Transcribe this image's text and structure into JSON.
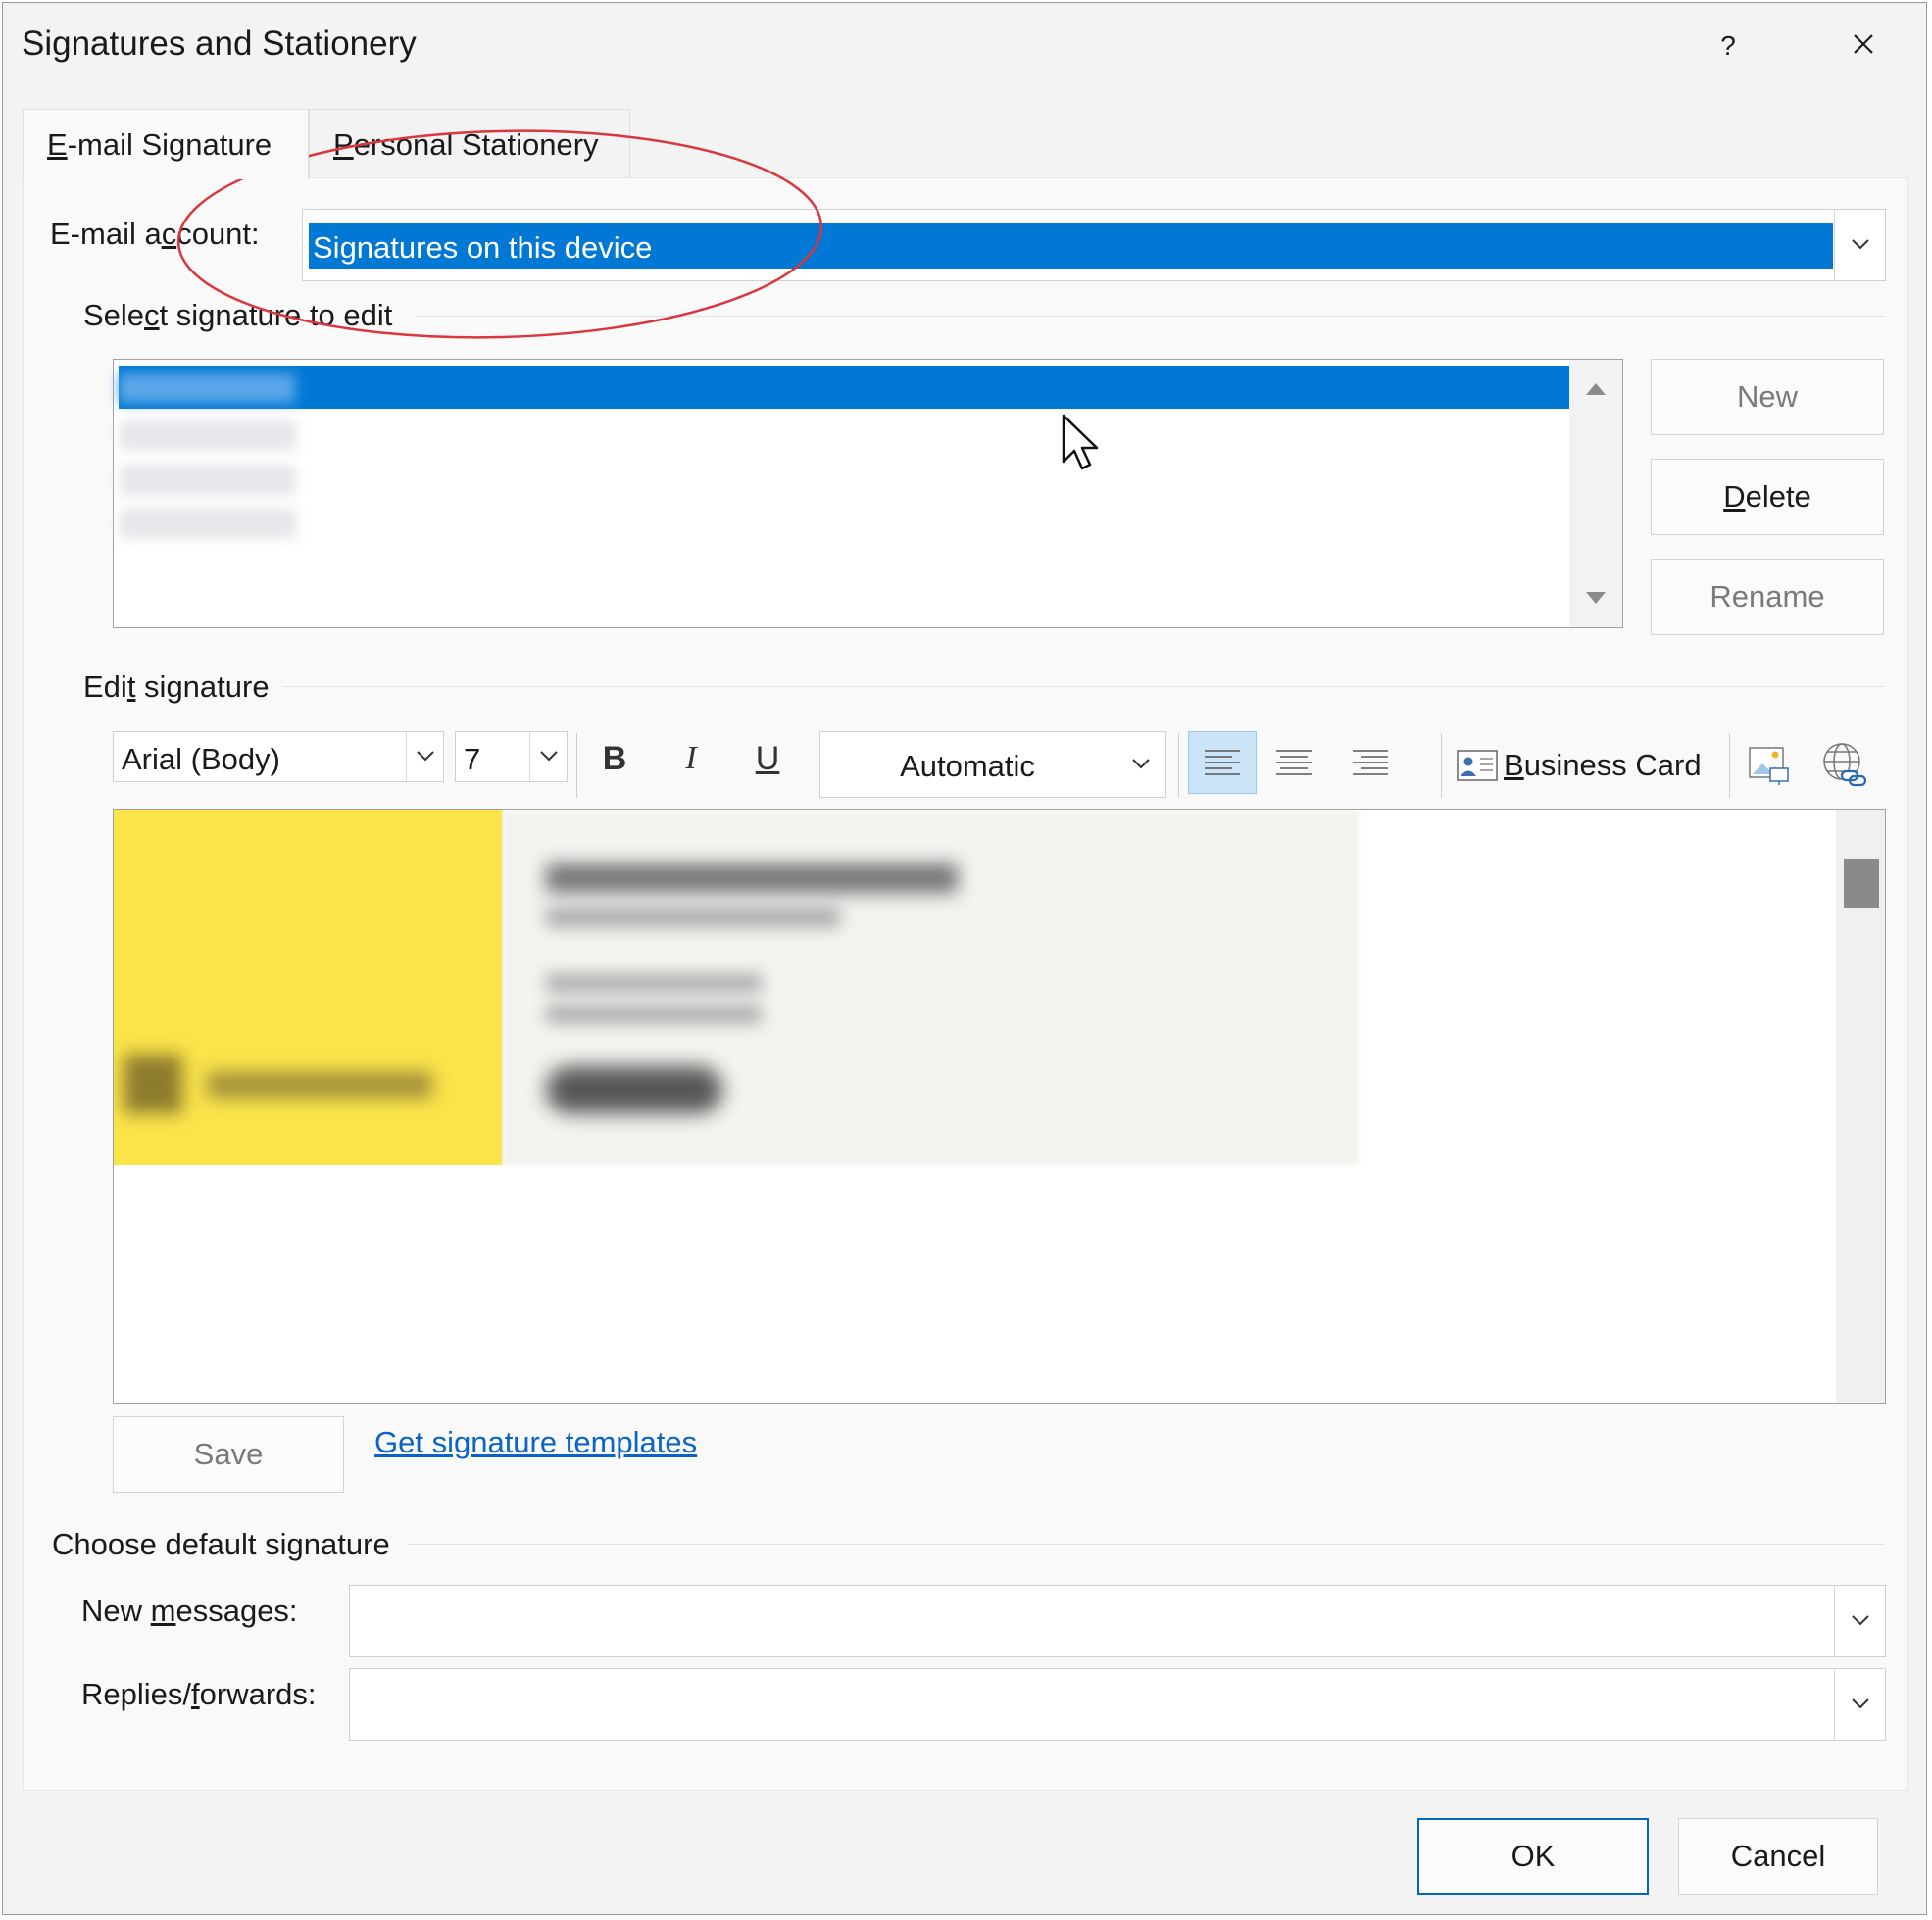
{
  "window": {
    "title": "Signatures and Stationery",
    "help_label": "?"
  },
  "tabs": [
    {
      "label": "E-mail Signature",
      "mnemonic": "E",
      "active": true
    },
    {
      "label": "Personal Stationery",
      "mnemonic": "P",
      "active": false
    }
  ],
  "email_account": {
    "label_prefix": "E-mail a",
    "label_mnemonic": "c",
    "label_suffix": "count:",
    "value": "Signatures on this device"
  },
  "select_signature": {
    "label_prefix": "Sele",
    "label_mnemonic": "c",
    "label_suffix": "t signature to edit",
    "items_blurred": true
  },
  "side_buttons": {
    "new_label": "New",
    "delete_mnemonic": "D",
    "delete_rest": "elete",
    "rename_label": "Rename"
  },
  "edit_signature": {
    "label_prefix": "Edi",
    "label_mnemonic": "t",
    "label_suffix": " signature"
  },
  "toolbar": {
    "font_name": "Arial (Body)",
    "font_size": "7",
    "bold": "B",
    "italic": "I",
    "underline": "U",
    "color_value": "Automatic",
    "business_card_mnemonic": "B",
    "business_card_rest": "usiness Card"
  },
  "signature_preview": {
    "content_blurred": true,
    "left_panel_color": "#fbe44a",
    "right_panel_color": "#f4f3f0"
  },
  "save_label": "Save",
  "templates_link": "Get signature templates",
  "default_signature": {
    "section_label": "Choose default signature",
    "new_messages_prefix": "New ",
    "new_messages_mnemonic": "m",
    "new_messages_suffix": "essages:",
    "new_messages_value": "",
    "replies_prefix": "Replies/",
    "replies_mnemonic": "f",
    "replies_suffix": "orwards:",
    "replies_value": ""
  },
  "footer": {
    "ok_label": "OK",
    "cancel_label": "Cancel"
  },
  "colors": {
    "selection": "#0078d4",
    "annotation": "#d9363e",
    "link": "#0a63c7"
  }
}
